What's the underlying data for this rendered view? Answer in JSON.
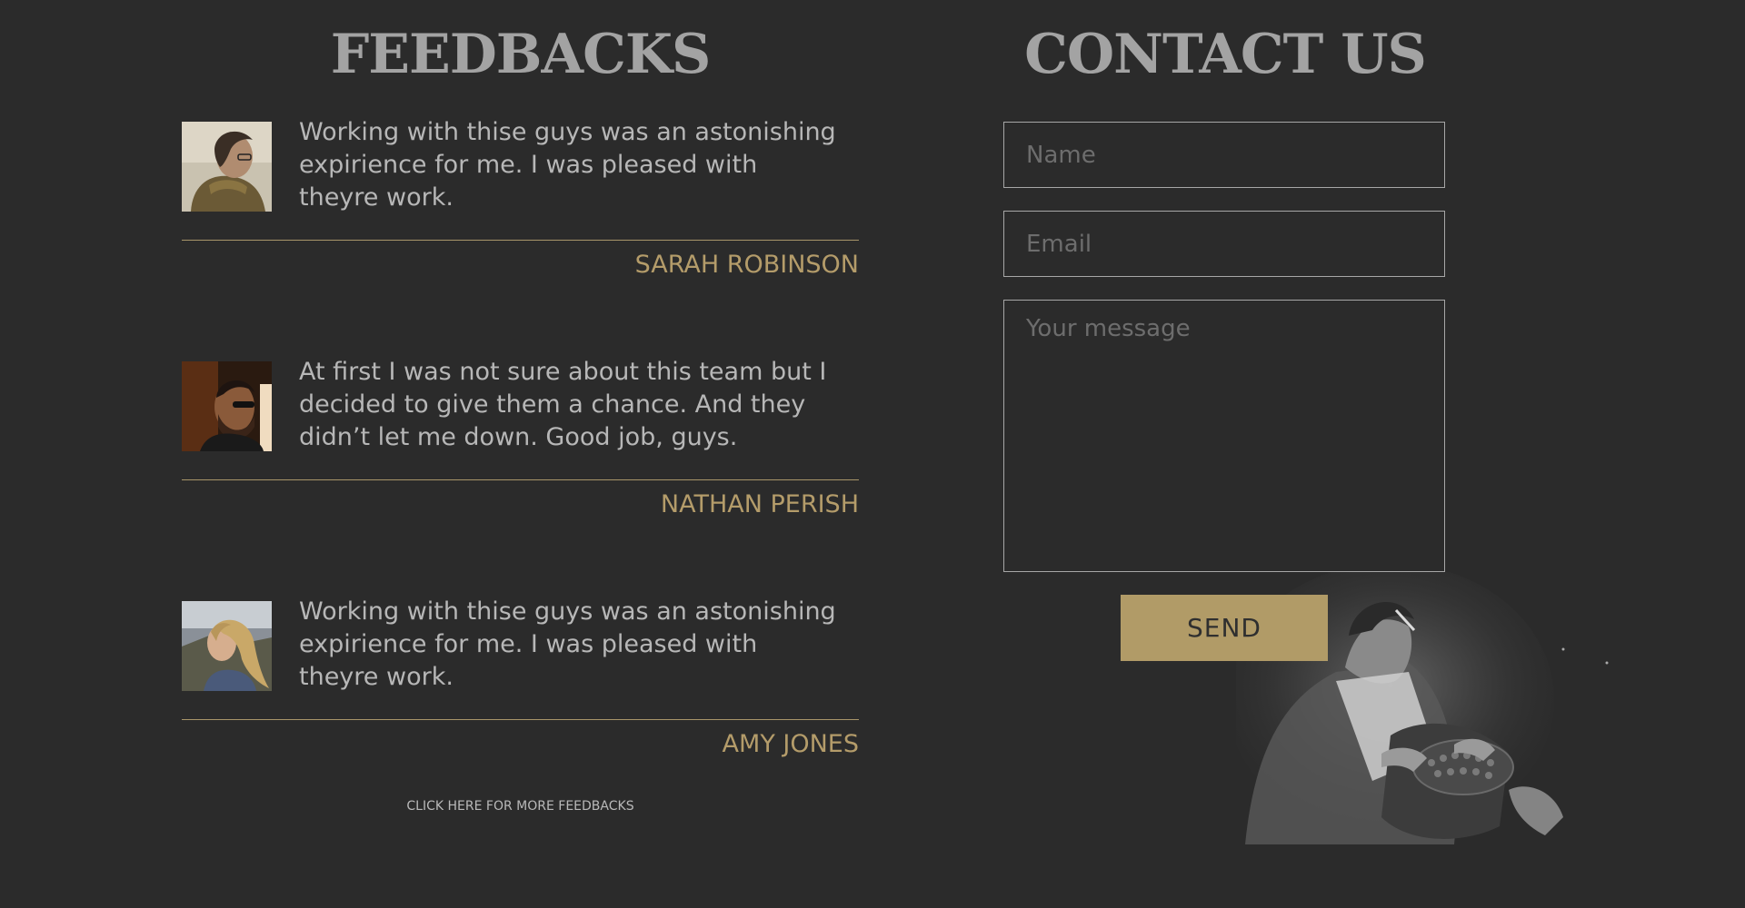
{
  "feedbacks": {
    "title": "FEEDBACKS",
    "items": [
      {
        "avatar": "man-with-scarf-photo",
        "quote": "Working with thise guys was an astonishing expirience for me. I was pleased with theyre work.",
        "author": "SARAH ROBINSON"
      },
      {
        "avatar": "bearded-man-in-car-photo",
        "quote": "At first I was not sure about this team but I decided to give them a chance. And they didn’t let me down. Good job, guys.",
        "author": "NATHAN PERISH"
      },
      {
        "avatar": "blonde-woman-photo",
        "quote": "Working with thise guys was an astonishing expirience for me. I was pleased with theyre work.",
        "author": "AMY JONES"
      }
    ],
    "more_link": "CLICK HERE FOR MORE FEEDBACKS"
  },
  "contact": {
    "title": "CONTACT US",
    "name_placeholder": "Name",
    "email_placeholder": "Email",
    "message_placeholder": "Your message",
    "send_label": "SEND",
    "background_image": "man-at-typewriter-photo"
  },
  "colors": {
    "background": "#2b2b2b",
    "heading": "#a3a3a3",
    "body_text": "#b7b7b7",
    "accent_gold": "#b19b67",
    "field_border": "#a7a7a7"
  }
}
